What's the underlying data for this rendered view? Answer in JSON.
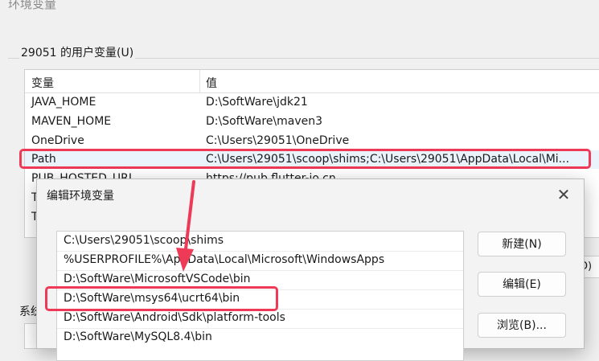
{
  "window": {
    "title": "环境变量"
  },
  "user_vars": {
    "group_label": "29051 的用户变量(U)",
    "columns": {
      "name": "变量",
      "value": "值"
    },
    "rows": [
      {
        "name": "JAVA_HOME",
        "value": "D:\\SoftWare\\jdk21"
      },
      {
        "name": "MAVEN_HOME",
        "value": "D:\\SoftWare\\maven3"
      },
      {
        "name": "OneDrive",
        "value": "C:\\Users\\29051\\OneDrive"
      },
      {
        "name": "Path",
        "value": "C:\\Users\\29051\\scoop\\shims;C:\\Users\\29051\\AppData\\Local\\Mi..."
      },
      {
        "name": "PUB_HOSTED_URL",
        "value": "https://pub.flutter-io.cn"
      },
      {
        "name": "T",
        "value": ""
      },
      {
        "name": "T",
        "value": ""
      }
    ],
    "partial_button": "D)"
  },
  "system_vars": {
    "group_label": "系统"
  },
  "dialog": {
    "title": "编辑环境变量",
    "close": "✕",
    "entries": [
      "C:\\Users\\29051\\scoop\\shims",
      "%USERPROFILE%\\AppData\\Local\\Microsoft\\WindowsApps",
      "D:\\SoftWare\\MicrosoftVSCode\\bin",
      "D:\\SoftWare\\msys64\\ucrt64\\bin",
      "D:\\SoftWare\\Android\\Sdk\\platform-tools",
      "D:\\SoftWare\\MySQL8.4\\bin"
    ],
    "buttons": {
      "new": "新建(N)",
      "edit": "编辑(E)",
      "browse": "浏览(B)..."
    }
  },
  "annotation": {
    "color": "#ee3a57"
  }
}
